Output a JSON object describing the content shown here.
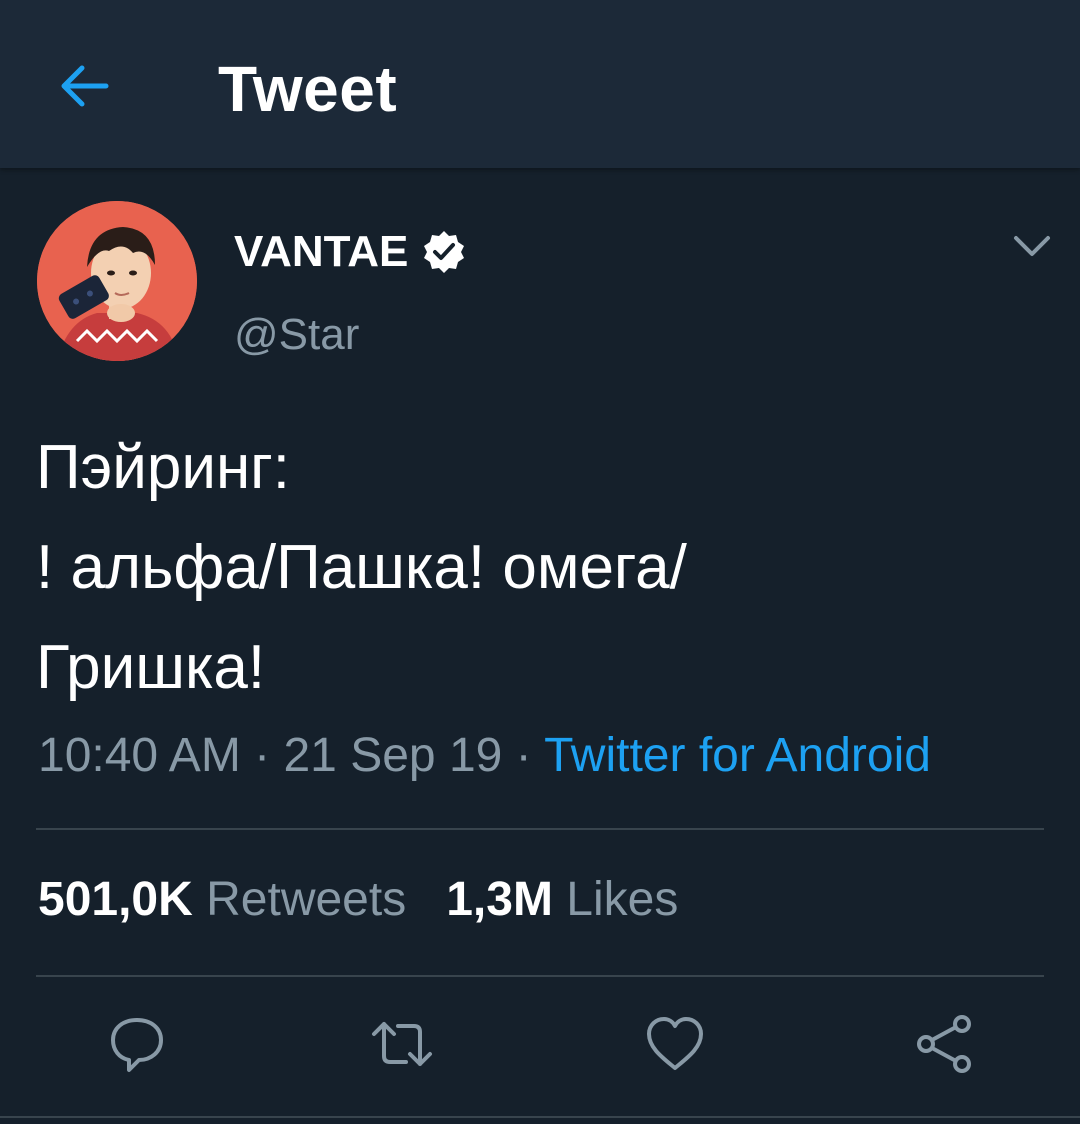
{
  "header": {
    "title": "Tweet",
    "back_icon": "arrow-left-icon"
  },
  "author": {
    "display_name": "VANTAE",
    "handle": "@Star",
    "verified": true,
    "avatar_bg": "#e8624f"
  },
  "tweet": {
    "text": "Пэйринг:\n! альфа/Пашка! омега/\nГришка!",
    "time": "10:40 AM",
    "date": "21 Sep 19",
    "source": "Twitter for Android",
    "separator": " · "
  },
  "stats": {
    "retweets_count": "501,0K",
    "retweets_label": "Retweets",
    "likes_count": "1,3M",
    "likes_label": "Likes"
  },
  "actions": [
    "reply-icon",
    "retweet-icon",
    "like-icon",
    "share-icon"
  ],
  "colors": {
    "background": "#15202b",
    "header": "#1c2938",
    "accent": "#1da1f2",
    "secondary_text": "#8899a6",
    "divider": "#38444d"
  }
}
